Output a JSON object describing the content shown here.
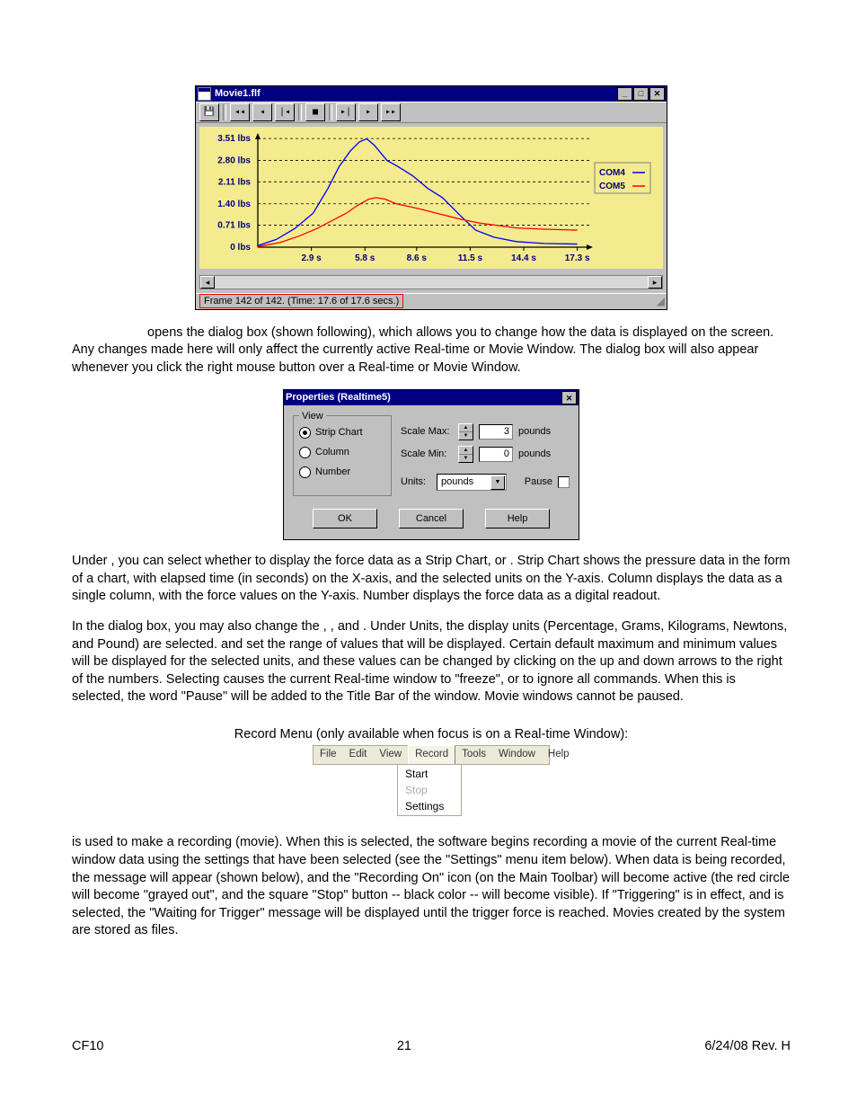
{
  "movie": {
    "title": "Movie1.flf",
    "status": "Frame 142 of 142. (Time: 17.6 of 17.6 secs.)"
  },
  "chart_data": {
    "type": "line",
    "xlabel": "",
    "ylabel": "",
    "y_ticks_labels": [
      "0 lbs",
      "0.71 lbs",
      "1.40 lbs",
      "2.11 lbs",
      "2.80 lbs",
      "3.51 lbs"
    ],
    "y_ticks_values": [
      0,
      0.71,
      1.4,
      2.11,
      2.8,
      3.51
    ],
    "x_ticks": [
      2.9,
      5.8,
      8.6,
      11.5,
      14.4,
      17.3
    ],
    "x_ticks_labels": [
      "2.9 s",
      "5.8 s",
      "8.6 s",
      "11.5 s",
      "14.4 s",
      "17.3 s"
    ],
    "xlim": [
      0,
      18
    ],
    "ylim": [
      0,
      3.6
    ],
    "series": [
      {
        "name": "COM4",
        "color": "#0000ff",
        "values": [
          [
            0,
            0.05
          ],
          [
            1,
            0.25
          ],
          [
            2,
            0.6
          ],
          [
            3,
            1.1
          ],
          [
            3.8,
            1.9
          ],
          [
            4.4,
            2.6
          ],
          [
            5.0,
            3.1
          ],
          [
            5.5,
            3.4
          ],
          [
            5.9,
            3.5
          ],
          [
            6.3,
            3.3
          ],
          [
            7.0,
            2.8
          ],
          [
            7.6,
            2.6
          ],
          [
            8.4,
            2.3
          ],
          [
            9.2,
            1.9
          ],
          [
            10.0,
            1.6
          ],
          [
            11.0,
            1.0
          ],
          [
            11.8,
            0.55
          ],
          [
            12.8,
            0.32
          ],
          [
            14.0,
            0.18
          ],
          [
            15.5,
            0.12
          ],
          [
            17.3,
            0.1
          ]
        ]
      },
      {
        "name": "COM5",
        "color": "#ff0000",
        "values": [
          [
            0,
            0.02
          ],
          [
            1.2,
            0.15
          ],
          [
            2.2,
            0.35
          ],
          [
            3.2,
            0.6
          ],
          [
            4.0,
            0.85
          ],
          [
            4.8,
            1.1
          ],
          [
            5.4,
            1.35
          ],
          [
            6.0,
            1.55
          ],
          [
            6.4,
            1.6
          ],
          [
            6.9,
            1.55
          ],
          [
            7.5,
            1.4
          ],
          [
            8.3,
            1.3
          ],
          [
            9.0,
            1.2
          ],
          [
            10.0,
            1.05
          ],
          [
            11.0,
            0.9
          ],
          [
            12.0,
            0.78
          ],
          [
            13.0,
            0.7
          ],
          [
            14.0,
            0.62
          ],
          [
            15.5,
            0.58
          ],
          [
            17.3,
            0.55
          ]
        ]
      }
    ],
    "legend_position": "right"
  },
  "properties": {
    "title": "Properties (Realtime5)",
    "view_legend": "View",
    "radios": {
      "strip": "Strip Chart",
      "column": "Column",
      "number": "Number"
    },
    "scale_max_label": "Scale Max:",
    "scale_max_value": "3",
    "scale_min_label": "Scale Min:",
    "scale_min_value": "0",
    "unit_suffix": "pounds",
    "units_label": "Units:",
    "units_value": "pounds",
    "pause_label": "Pause",
    "ok": "OK",
    "cancel": "Cancel",
    "help": "Help"
  },
  "menu": {
    "items": [
      "File",
      "Edit",
      "View",
      "Record",
      "Tools",
      "Window",
      "Help"
    ],
    "popup": [
      "Start",
      "Stop",
      "Settings"
    ]
  },
  "text": {
    "p1": " opens the                dialog box (shown following), which allows you to change how the data is displayed on the screen. Any changes made here will only affect the currently active Real-time or Movie Window. The                  dialog box will also appear whenever you click the right mouse button over a Real-time or Movie Window.",
    "p2": "Under        , you can select whether to display the force data as a Strip Chart,                or            . Strip Chart shows the pressure data in the form of a chart, with elapsed time (in seconds) on the X-axis, and the selected units on the Y-axis. Column displays the data as a single column, with the force values on the Y-axis. Number displays the force data as a digital readout.",
    "p3": "In the                 dialog box, you may also change the                ,                , and         . Under Units, the display units (Percentage, Grams, Kilograms, Newtons, and Pound) are selected.                   and                  set the range of values that will be displayed. Certain default maximum and minimum values will be displayed for the selected units, and these values can be changed by clicking on the up and down arrows to the right of the numbers. Selecting            causes the current Real-time window to \"freeze\", or to ignore all commands. When this is selected, the word \"Pause\" will be added to the Title Bar of the window. Movie windows cannot be paused.",
    "p4_label": "Record Menu (only available when focus is on a Real-time Window):",
    "p5": "         is used to make a recording (movie). When this is selected, the software begins recording a movie of the current Real-time window data using the settings that have been selected (see the \"Settings\" menu item below). When data is being recorded, the                   message will appear (shown below), and the \"Recording On\" icon (on the Main Toolbar) will become active (the red circle will become \"grayed out\", and the square \"Stop\" button -- black color -- will become visible). If \"Triggering\" is in effect, and            is selected, the \"Waiting for Trigger\" message will be displayed until the trigger force is reached. Movies created by the          system are stored as        files."
  },
  "footer": {
    "left": "CF10",
    "center": "21",
    "right": "6/24/08 Rev. H"
  }
}
